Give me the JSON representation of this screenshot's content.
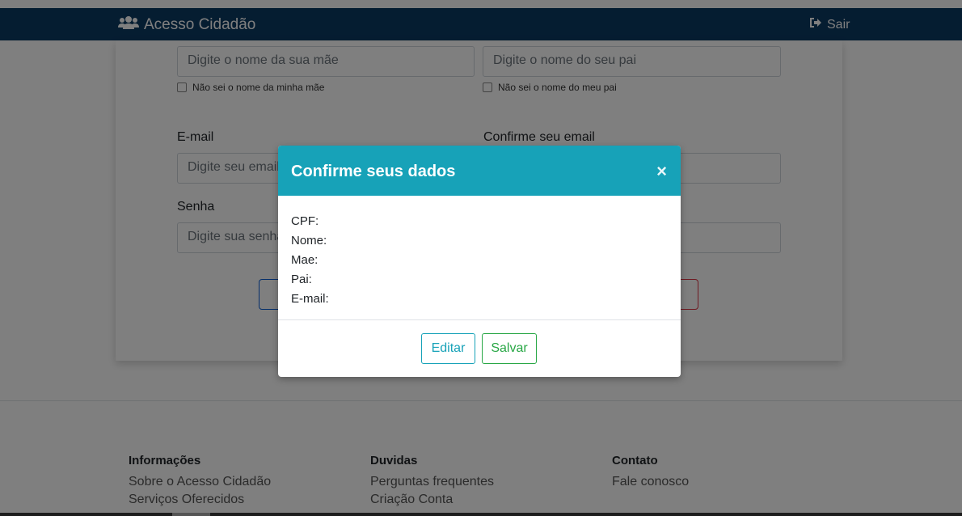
{
  "navbar": {
    "brand": "Acesso Cidadão",
    "brand_icon": "users-icon",
    "logout": "Sair",
    "logout_icon": "sign-out-icon",
    "color": "#0b3a63"
  },
  "form": {
    "mother_placeholder": "Digite o nome da sua mãe",
    "father_placeholder": "Digite o nome do seu pai",
    "no_mother_label": "Não sei o nome da minha mãe",
    "no_father_label": "Não sei o nome do meu pai",
    "email_label": "E-mail",
    "email_placeholder": "Digite seu email",
    "confirm_email_label": "Confirme seu email",
    "password_label": "Senha",
    "password_placeholder": "Digite sua senha"
  },
  "modal": {
    "title": "Confirme seus dados",
    "close_symbol": "×",
    "header_color": "#17a2b8",
    "fields": [
      "CPF:",
      "Nome:",
      "Mae:",
      "Pai:",
      "E-mail:"
    ],
    "edit_label": "Editar",
    "save_label": "Salvar"
  },
  "footer": {
    "columns": [
      {
        "title": "Informações",
        "links": [
          "Sobre o Acesso Cidadão",
          "Serviços Oferecidos"
        ]
      },
      {
        "title": "Duvidas",
        "links": [
          "Perguntas frequentes",
          "Criação Conta"
        ]
      },
      {
        "title": "Contato",
        "links": [
          "Fale conosco"
        ]
      }
    ]
  }
}
